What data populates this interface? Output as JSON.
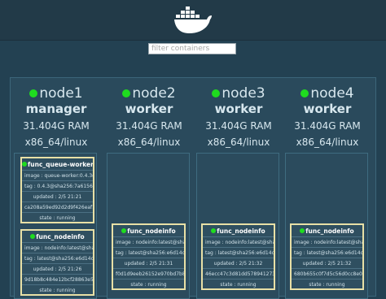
{
  "header": {
    "logo_icon": "docker-whale-icon"
  },
  "filter": {
    "placeholder": "filter containers",
    "value": ""
  },
  "colors": {
    "status_ok": "#1fdc1f",
    "task_border": "#e8e0a6"
  },
  "nodes": [
    {
      "name": "node1",
      "role": "manager",
      "ram": "31.404G RAM",
      "arch": "x86_64/linux",
      "tasks": [
        {
          "name": "func_queue-worker",
          "image": "image : queue-worker:0.4.3@sha256:...",
          "tag": "tag : 0.4.3@sha256:7a615648597585...",
          "hash": "ca208a59ed92d2d9f426eaf1d...",
          "updated": "updated : 2/5 21:21",
          "state": "state : running"
        },
        {
          "name": "func_nodeinfo",
          "image": "image : nodeinfo:latest@sha256:e6d...",
          "tag": "tag : latest@sha256:e6d14cf6bb833...",
          "updated": "updated : 2/5 21:26",
          "hash": "9d18b8c484e12bcf28863e5d4...",
          "state": "state : running"
        }
      ]
    },
    {
      "name": "node2",
      "role": "worker",
      "ram": "31.404G RAM",
      "arch": "x86_64/linux",
      "tasks": [
        {
          "name": "func_nodeinfo",
          "image": "image : nodeinfo:latest@sha256:e6d...",
          "tag": "tag : latest@sha256:e6d14cf6bb833...",
          "updated": "updated : 2/5 21:31",
          "hash": "f0d1d9eeb26152e970bd7b8516241...",
          "state": "state : running"
        }
      ]
    },
    {
      "name": "node3",
      "role": "worker",
      "ram": "31.404G RAM",
      "arch": "x86_64/linux",
      "tasks": [
        {
          "name": "func_nodeinfo",
          "image": "image : nodeinfo:latest@sha256:e6d...",
          "tag": "tag : latest@sha256:e6d14cf6bb833...",
          "updated": "updated : 2/5 21:32",
          "hash": "46ecc47c3d81dd5789412735e8c5a...",
          "state": "state : running"
        }
      ]
    },
    {
      "name": "node4",
      "role": "worker",
      "ram": "31.404G RAM",
      "arch": "x86_64/linux",
      "tasks": [
        {
          "name": "func_nodeinfo",
          "image": "image : nodeinfo:latest@sha256:e6d...",
          "tag": "tag : latest@sha256:e6d14cf6bb833...",
          "updated": "updated : 2/5 21:32",
          "hash": "680b655c0f7d5c56d0cc8e060a...",
          "state": "state : running"
        }
      ]
    }
  ]
}
